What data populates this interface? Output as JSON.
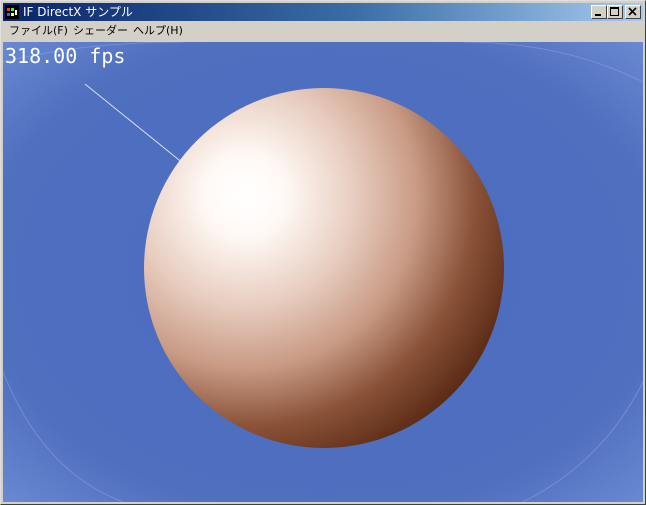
{
  "window": {
    "title": "IF DirectX サンプル",
    "icon": "directx-app-icon",
    "controls": [
      "minimize",
      "maximize",
      "close"
    ]
  },
  "menu": {
    "items": [
      {
        "label": "ファイル(F)"
      },
      {
        "label": "シェーダー"
      },
      {
        "label": "ヘルプ(H)"
      }
    ]
  },
  "viewport": {
    "fps_text": "318.00 fps",
    "background_color": "#4f6fbf",
    "sphere_color": "#e8c3b3"
  }
}
